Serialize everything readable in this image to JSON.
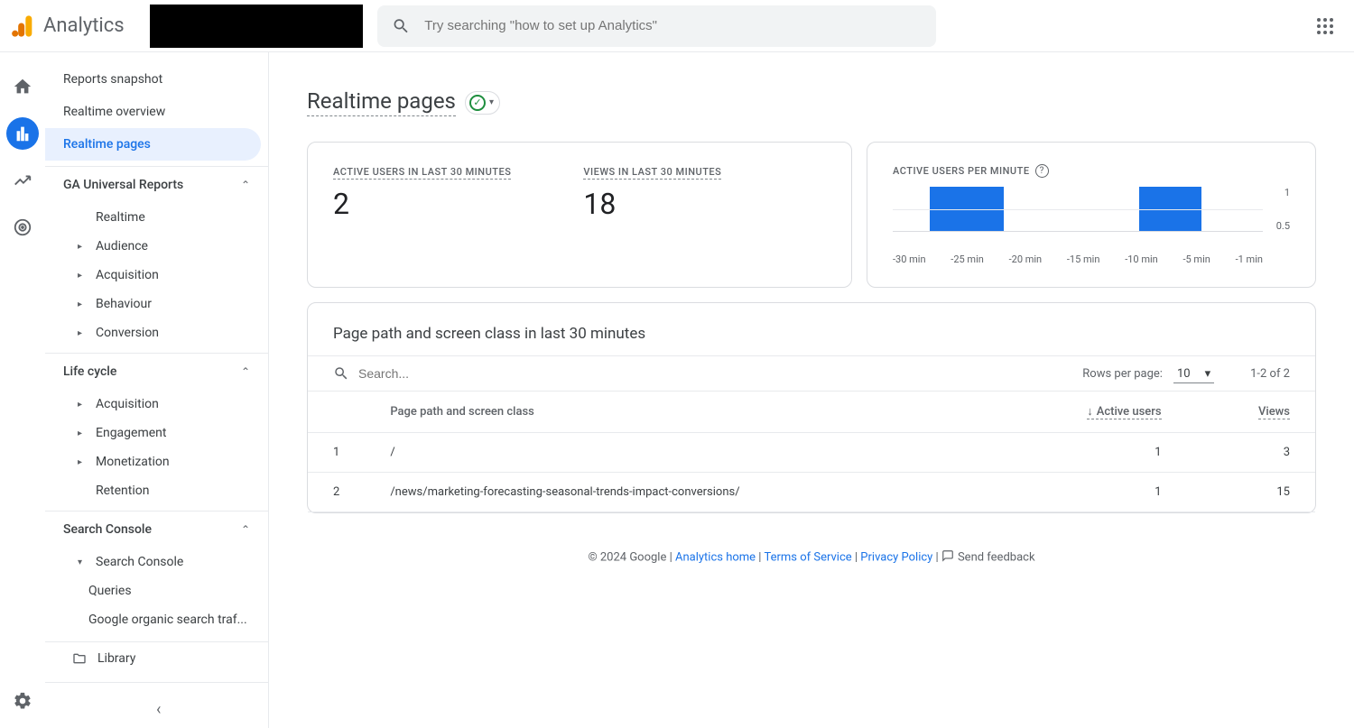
{
  "header": {
    "app_name": "Analytics",
    "search_placeholder": "Try searching \"how to set up Analytics\""
  },
  "sidebar": {
    "items_top": [
      {
        "label": "Reports snapshot"
      },
      {
        "label": "Realtime overview"
      },
      {
        "label": "Realtime pages",
        "active": true
      }
    ],
    "sections": [
      {
        "label": "GA Universal Reports",
        "items": [
          {
            "label": "Realtime",
            "expandable": false
          },
          {
            "label": "Audience",
            "expandable": true
          },
          {
            "label": "Acquisition",
            "expandable": true
          },
          {
            "label": "Behaviour",
            "expandable": true
          },
          {
            "label": "Conversion",
            "expandable": true
          }
        ]
      },
      {
        "label": "Life cycle",
        "items": [
          {
            "label": "Acquisition",
            "expandable": true
          },
          {
            "label": "Engagement",
            "expandable": true
          },
          {
            "label": "Monetization",
            "expandable": true
          },
          {
            "label": "Retention",
            "expandable": false
          }
        ]
      },
      {
        "label": "Search Console",
        "items": [
          {
            "label": "Search Console",
            "expandable": true,
            "expanded": true,
            "children": [
              {
                "label": "Queries"
              },
              {
                "label": "Google organic search traf..."
              }
            ]
          }
        ]
      }
    ],
    "library_label": "Library"
  },
  "page": {
    "title": "Realtime pages",
    "metrics": [
      {
        "label": "Active users in last 30 minutes",
        "value": "2"
      },
      {
        "label": "Views in last 30 minutes",
        "value": "18"
      }
    ],
    "chart_title": "Active users per minute",
    "table_title": "Page path and screen class in last 30 minutes",
    "table_search_placeholder": "Search...",
    "rows_per_page_label": "Rows per page:",
    "rows_per_page_value": "10",
    "page_info": "1-2 of 2",
    "columns": {
      "path": "Page path and screen class",
      "active_users": "Active users",
      "views": "Views"
    },
    "rows": [
      {
        "idx": "1",
        "path": "/",
        "active_users": "1",
        "views": "3"
      },
      {
        "idx": "2",
        "path": "/news/marketing-forecasting-seasonal-trends-impact-conversions/",
        "active_users": "1",
        "views": "15"
      }
    ]
  },
  "chart_data": {
    "type": "bar",
    "title": "Active users per minute",
    "xlabel": "",
    "ylabel": "",
    "ylim": [
      0,
      1
    ],
    "y_ticks": [
      "1",
      "0.5"
    ],
    "x_ticks": [
      "-30 min",
      "-25 min",
      "-20 min",
      "-15 min",
      "-10 min",
      "-5 min",
      "-1 min"
    ],
    "values": [
      0,
      0,
      0,
      1,
      1,
      1,
      1,
      1,
      1,
      0,
      0,
      0,
      0,
      0,
      0,
      0,
      0,
      0,
      0,
      0,
      1,
      1,
      1,
      1,
      1,
      0,
      0,
      0,
      0,
      0
    ]
  },
  "footer": {
    "copyright": "© 2024 Google",
    "analytics_home": "Analytics home",
    "terms": "Terms of Service",
    "privacy": "Privacy Policy",
    "feedback": "Send feedback"
  }
}
